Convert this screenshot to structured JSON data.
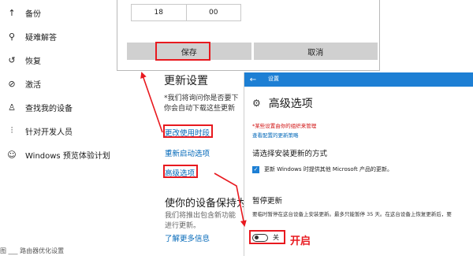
{
  "sidebar": {
    "items": [
      {
        "icon": "upload-arrow-icon",
        "glyph": "↑",
        "label": "备份"
      },
      {
        "icon": "wrench-icon",
        "glyph": "⚲",
        "label": "疑难解答"
      },
      {
        "icon": "restore-icon",
        "glyph": "↺",
        "label": "恢复"
      },
      {
        "icon": "check-circle-icon",
        "glyph": "⊘",
        "label": "激活"
      },
      {
        "icon": "person-icon",
        "glyph": "♙",
        "label": "查找我的设备"
      },
      {
        "icon": "developer-icon",
        "glyph": "⫶",
        "label": "针对开发人员"
      },
      {
        "icon": "windows-insider-icon",
        "glyph": "☺",
        "label": "Windows 预览体验计划"
      }
    ],
    "cut_text": "图 ___ 路由器优化设置"
  },
  "dialog": {
    "start_hour": "18",
    "start_minute": "00",
    "save_label": "保存",
    "cancel_label": "取消"
  },
  "update_section": {
    "title": "更新设置",
    "note_line1": "*我们将询问你是否要下",
    "note_line2": "你会自动下载这些更新",
    "link_change_hours": "更改使用时段",
    "link_restart": "重新启动选项",
    "link_advanced": "高级选项",
    "title2": "使你的设备保持为",
    "note2_line1": "我们将推出包含新功能",
    "note2_line2": "进行更新。",
    "link_learn_more": "了解更多信息"
  },
  "advanced_window": {
    "titlebar": "设置",
    "page_title": "高级选项",
    "managed_note": "*某些设置由你的组织来管理",
    "policy_link": "查看配置的更新策略",
    "install_heading": "请选择安装更新的方式",
    "checkbox_label": "更新 Windows 时提供其他 Microsoft 产品的更新。",
    "checkbox_checked": true,
    "pause_heading": "暂停更新",
    "pause_desc": "要临时暂停在这台设备上安装更新。最多只能暂停 35 天。在这台设备上恢复更新后，要",
    "toggle_state": "关",
    "toggle_on": false
  },
  "annotation": {
    "enable_label": "开启",
    "color": "#e8191f"
  },
  "colors": {
    "accent": "#1d7fd4",
    "link": "#0067b8",
    "highlight_red": "#e8191f"
  }
}
